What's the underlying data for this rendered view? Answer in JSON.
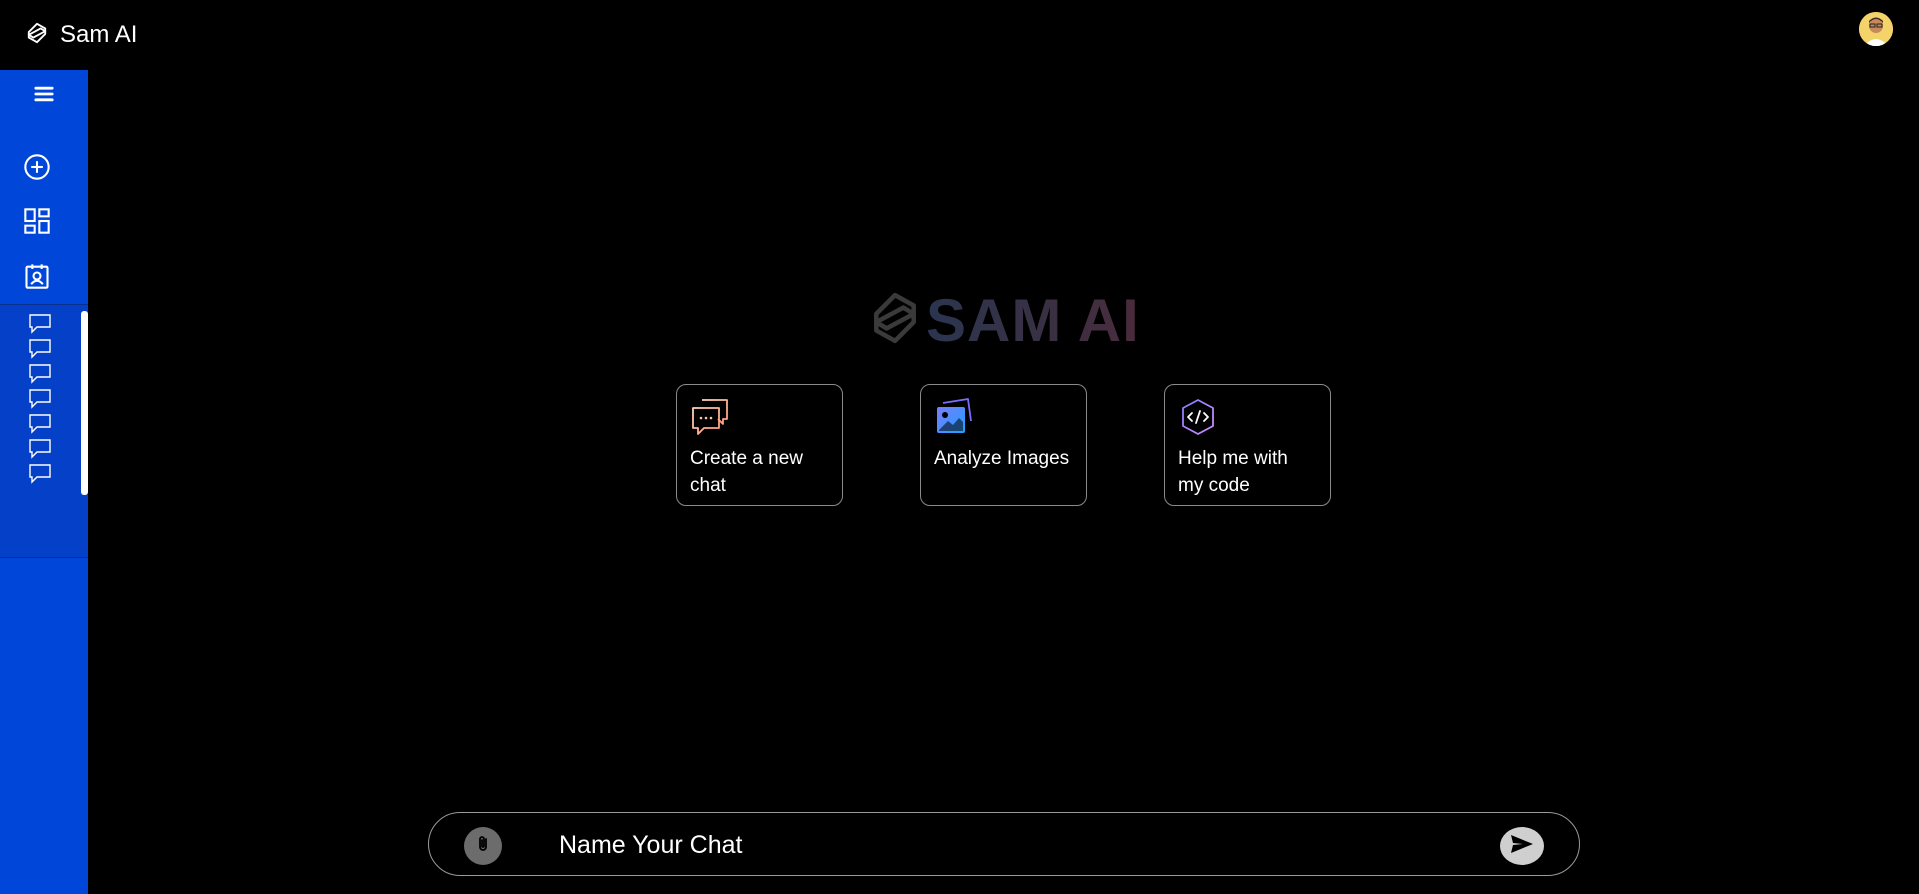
{
  "app": {
    "title": "Sam AI",
    "logo_icon": "sam-ai-logo-icon"
  },
  "header": {
    "avatar_icon": "user-avatar"
  },
  "sidebar": {
    "icons": [
      "menu-icon",
      "new-chat-plus-icon",
      "dashboard-grid-icon",
      "contact-calendar-icon"
    ],
    "history_count": 7,
    "history_icon": "chat-bubble-icon"
  },
  "hero": {
    "logo_text": "SAM AI"
  },
  "cards": [
    {
      "label": "Create a new chat",
      "icon": "chat-bubbles-icon"
    },
    {
      "label": "Analyze Images",
      "icon": "images-icon"
    },
    {
      "label": "Help me with my code",
      "icon": "code-hexagon-icon"
    }
  ],
  "chatbar": {
    "placeholder": "Name Your Chat",
    "attach_icon": "paperclip-icon",
    "send_icon": "send-icon"
  },
  "colors": {
    "sidebar": "#0046d9",
    "background": "#000000",
    "card_border": "#8a8a8a"
  }
}
